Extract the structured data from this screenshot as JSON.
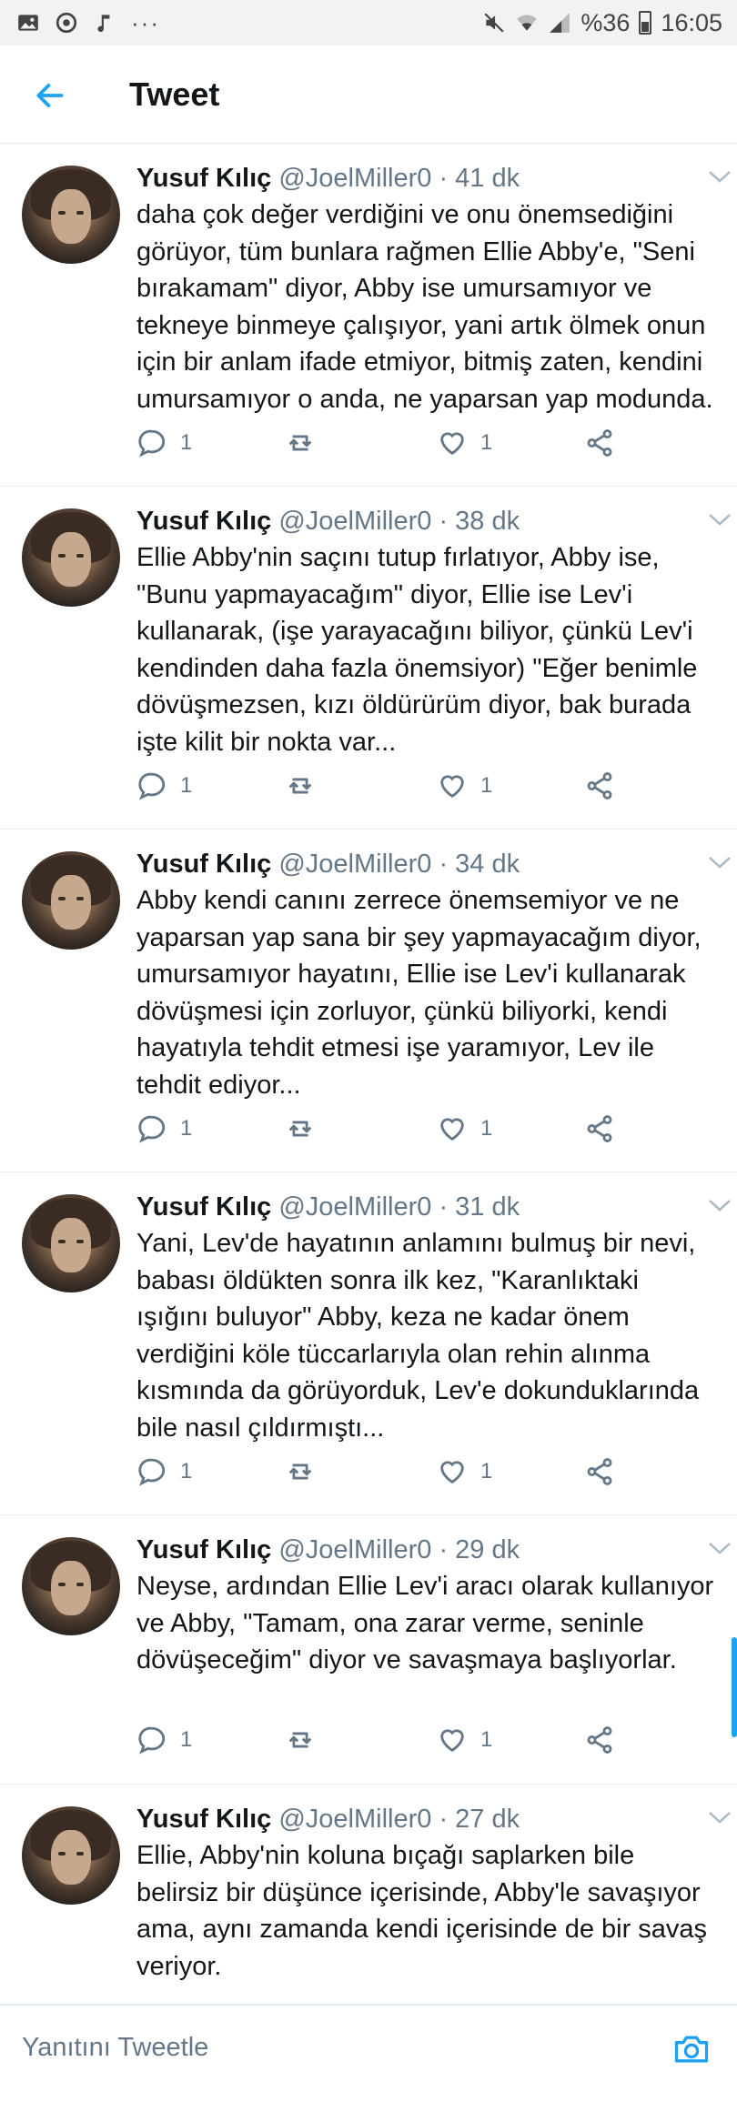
{
  "status_bar": {
    "battery": "%36",
    "time": "16:05",
    "left_icons": [
      "image-icon",
      "sync-icon",
      "music-icon",
      "more-dots-icon"
    ],
    "right_icons": [
      "mute-icon",
      "wifi-icon",
      "signal-icon",
      "battery-icon"
    ]
  },
  "header": {
    "title": "Tweet"
  },
  "colors": {
    "accent": "#1da1f2",
    "text": "#14171a",
    "secondary": "#657786"
  },
  "tweets": [
    {
      "name": "Yusuf Kılıç",
      "handle": "@JoelMiller0",
      "sep": "·",
      "time": "41 dk",
      "text": "daha çok değer verdiğini ve onu önemsediğini görüyor, tüm bunlara rağmen Ellie Abby'e, \"Seni bırakamam\" diyor, Abby ise umursamıyor ve tekneye binmeye çalışıyor, yani artık ölmek onun için bir anlam ifade etmiyor, bitmiş zaten, kendini umursamıyor o anda, ne yaparsan yap modunda.",
      "replies": "1",
      "likes": "1"
    },
    {
      "name": "Yusuf Kılıç",
      "handle": "@JoelMiller0",
      "sep": "·",
      "time": "38 dk",
      "text": "Ellie Abby'nin saçını tutup fırlatıyor, Abby ise, \"Bunu yapmayacağım\" diyor, Ellie ise Lev'i kullanarak, (işe yarayacağını biliyor, çünkü Lev'i kendinden daha fazla önemsiyor) \"Eğer benimle dövüşmezsen, kızı öldürürüm diyor, bak burada işte kilit bir nokta var...",
      "replies": "1",
      "likes": "1"
    },
    {
      "name": "Yusuf Kılıç",
      "handle": "@JoelMiller0",
      "sep": "·",
      "time": "34 dk",
      "text": "Abby kendi canını zerrece önemsemiyor ve ne yaparsan yap sana bir şey yapmayacağım diyor, umursamıyor hayatını, Ellie ise Lev'i kullanarak dövüşmesi için zorluyor, çünkü biliyorki, kendi hayatıyla tehdit etmesi işe yaramıyor, Lev ile tehdit ediyor...",
      "replies": "1",
      "likes": "1"
    },
    {
      "name": "Yusuf Kılıç",
      "handle": "@JoelMiller0",
      "sep": "·",
      "time": "31 dk",
      "text": "Yani, Lev'de hayatının anlamını bulmuş bir nevi, babası öldükten sonra ilk kez, \"Karanlıktaki ışığını buluyor\" Abby, keza ne kadar önem verdiğini köle tüccarlarıyla olan rehin alınma kısmında da görüyorduk, Lev'e dokunduklarında bile nasıl çıldırmıştı...",
      "replies": "1",
      "likes": "1"
    },
    {
      "name": "Yusuf Kılıç",
      "handle": "@JoelMiller0",
      "sep": "·",
      "time": "29 dk",
      "text": "Neyse, ardından Ellie Lev'i aracı olarak kullanıyor ve Abby, \"Tamam, ona zarar verme, seninle dövüşeceğim\" diyor ve savaşmaya başlıyorlar.",
      "replies": "1",
      "likes": "1"
    },
    {
      "name": "Yusuf Kılıç",
      "handle": "@JoelMiller0",
      "sep": "·",
      "time": "27 dk",
      "text": "Ellie, Abby'nin koluna bıçağı saplarken bile belirsiz bir düşünce içerisinde, Abby'le savaşıyor ama, aynı zamanda kendi içerisinde de bir savaş veriyor.",
      "replies": "",
      "likes": ""
    }
  ],
  "reply_bar": {
    "placeholder": "Yanıtını Tweetle"
  }
}
